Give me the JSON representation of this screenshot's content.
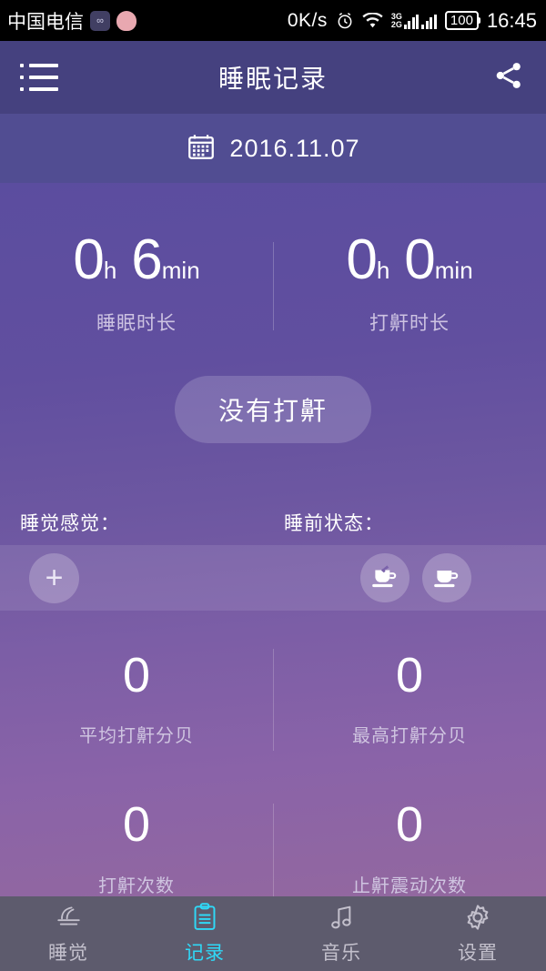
{
  "statusbar": {
    "carrier": "中国电信",
    "badge_icons": [
      "wechat-style-badge",
      "heart-badge"
    ],
    "network_speed": "0K/s",
    "alarm_icon": "alarm-clock-icon",
    "wifi_icon": "wifi-icon",
    "signal_3g_label": "3G",
    "signal_2g_label": "2G",
    "battery_level": "100",
    "clock": "16:45"
  },
  "appbar": {
    "menu_icon": "list-menu-icon",
    "title": "睡眠记录",
    "share_icon": "share-icon"
  },
  "datebar": {
    "calendar_icon": "calendar-icon",
    "date": "2016.11.07"
  },
  "top_stats": [
    {
      "value": "0",
      "unit1": "h",
      "value2": "6",
      "unit2": "min",
      "label": "睡眠时长"
    },
    {
      "value": "0",
      "unit1": "h",
      "value2": "0",
      "unit2": "min",
      "label": "打鼾时长"
    }
  ],
  "snore_status_button": "没有打鼾",
  "mood": {
    "feeling_label": "睡觉感觉：",
    "pre_sleep_label": "睡前状态：",
    "add_button": "+",
    "pre_sleep_icons": [
      "tea-cup-icon",
      "coffee-cup-icon"
    ]
  },
  "grid_stats": [
    {
      "value": "0",
      "label": "平均打鼾分贝"
    },
    {
      "value": "0",
      "label": "最高打鼾分贝"
    },
    {
      "value": "0",
      "label": "打鼾次数"
    },
    {
      "value": "0",
      "label": "止鼾震动次数"
    }
  ],
  "bottom_nav": [
    {
      "label": "睡觉",
      "icon": "bed-icon",
      "active": false
    },
    {
      "label": "记录",
      "icon": "clipboard-icon",
      "active": true
    },
    {
      "label": "音乐",
      "icon": "music-note-icon",
      "active": false
    },
    {
      "label": "设置",
      "icon": "gear-icon",
      "active": false
    }
  ],
  "colors": {
    "header": "#45417f",
    "datebar": "#514d92",
    "accent": "#2fd9f7",
    "navbar": "#5d5b6d"
  }
}
